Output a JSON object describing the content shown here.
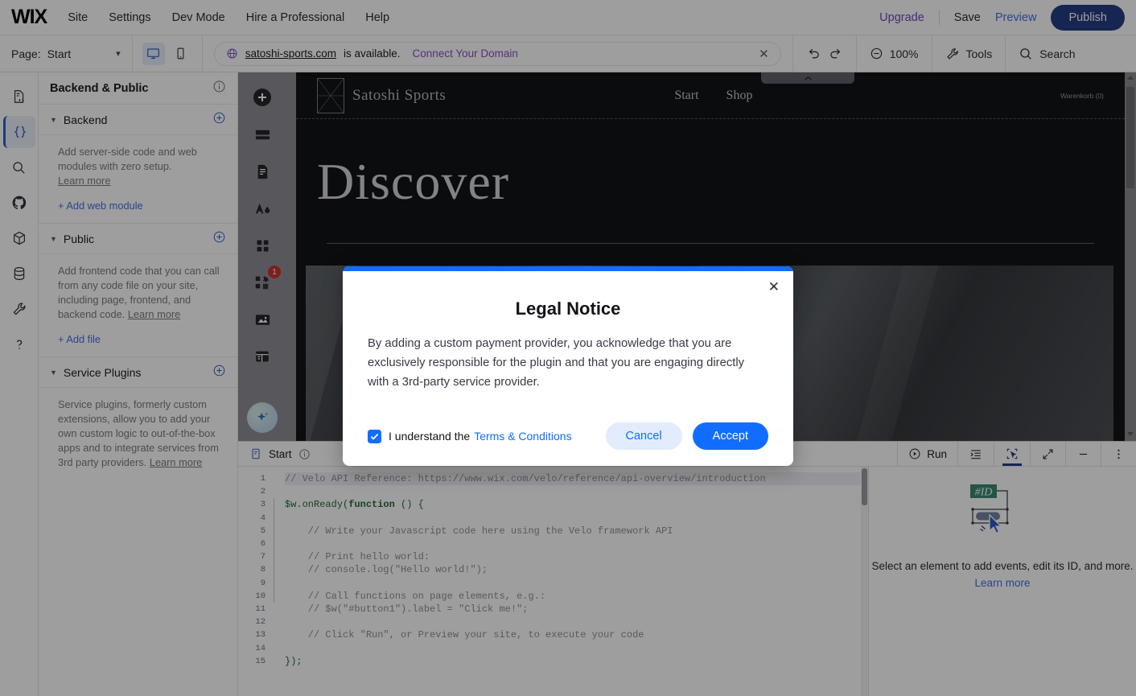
{
  "topbar": {
    "logo": "WIX",
    "nav": [
      "Site",
      "Settings",
      "Dev Mode",
      "Hire a Professional",
      "Help"
    ],
    "upgrade": "Upgrade",
    "save": "Save",
    "preview": "Preview",
    "publish": "Publish"
  },
  "toolbar2": {
    "page_label": "Page:",
    "page_value": "Start",
    "domain_name": "satoshi-sports.com",
    "domain_available": "is available.",
    "domain_cta": "Connect Your Domain",
    "zoom": "100%",
    "tools": "Tools",
    "search": "Search"
  },
  "rail": {
    "items": [
      {
        "name": "code-files-icon",
        "active": false
      },
      {
        "name": "velo-braces-icon",
        "active": true
      },
      {
        "name": "search-icon",
        "active": false
      },
      {
        "name": "github-icon",
        "active": false
      },
      {
        "name": "packages-icon",
        "active": false
      },
      {
        "name": "database-icon",
        "active": false
      },
      {
        "name": "tools-wrench-icon",
        "active": false
      },
      {
        "name": "help-question-icon",
        "active": false
      }
    ]
  },
  "filepanel": {
    "title": "Backend & Public",
    "sections": [
      {
        "name": "Backend",
        "description": "Add server-side code and web modules with zero setup.",
        "learn_more": "Learn more",
        "add_link": "+ Add web module"
      },
      {
        "name": "Public",
        "description": "Add frontend code that you can call from any code file on your site, including page, frontend, and backend code.",
        "learn_more": "Learn more",
        "add_link": "+ Add file"
      },
      {
        "name": "Service Plugins",
        "description": "Service plugins, formerly custom extensions, allow you to add your own custom logic to out-of-the-box apps and to integrate services from 3rd party providers.",
        "learn_more": "Learn more",
        "add_link": ""
      }
    ]
  },
  "addrail": {
    "items": [
      {
        "name": "add-plus-icon",
        "badge": ""
      },
      {
        "name": "sections-icon",
        "badge": ""
      },
      {
        "name": "page-text-icon",
        "badge": ""
      },
      {
        "name": "design-theme-icon",
        "badge": ""
      },
      {
        "name": "apps-grid-icon",
        "badge": ""
      },
      {
        "name": "app-market-icon",
        "badge": "1"
      },
      {
        "name": "media-image-icon",
        "badge": ""
      },
      {
        "name": "cms-table-icon",
        "badge": ""
      }
    ],
    "ai_assistant": "ai-sparkle-icon"
  },
  "site": {
    "brand": "Satoshi Sports",
    "nav": [
      "Start",
      "Shop"
    ],
    "cart": "Warenkorb (0)",
    "heading": "Discover"
  },
  "codepanel": {
    "tab": "Start",
    "run": "Run",
    "buttons": [
      "format-code-icon",
      "element-selector-icon",
      "expand-icon",
      "minimize-icon",
      "more-options-icon"
    ],
    "line_numbers": [
      "1",
      "2",
      "3",
      "4",
      "5",
      "6",
      "7",
      "8",
      "9",
      "10",
      "11",
      "12",
      "13",
      "14",
      "15"
    ],
    "code": {
      "l1_prefix": "// Velo API Reference: ",
      "l1_url": "https://www.wix.com/velo/reference/api-overview/introduction",
      "l3_a": "$w",
      "l3_b": ".onReady(",
      "l3_c": "function",
      "l3_d": " () {",
      "l5": "    // Write your Javascript code here using the Velo framework API",
      "l7": "    // Print hello world:",
      "l8": "    // console.log(\"Hello world!\");",
      "l10": "    // Call functions on page elements, e.g.:",
      "l11": "    // $w(\"#button1\").label = \"Click me!\";",
      "l13": "    // Click \"Run\", or Preview your site, to execute your code",
      "l15": "});"
    },
    "properties": {
      "id_badge": "#ID",
      "message": "Select an element to add events, edit its ID, and more.",
      "learn_more": "Learn more"
    }
  },
  "modal": {
    "title": "Legal Notice",
    "body": "By adding a custom payment provider, you acknowledge that you are exclusively responsible for the plugin and that you are engaging directly with a 3rd-party service provider.",
    "checkbox_label": "I understand the",
    "terms_link": "Terms & Conditions",
    "cancel": "Cancel",
    "accept": "Accept",
    "accent_color": "#116dff"
  }
}
